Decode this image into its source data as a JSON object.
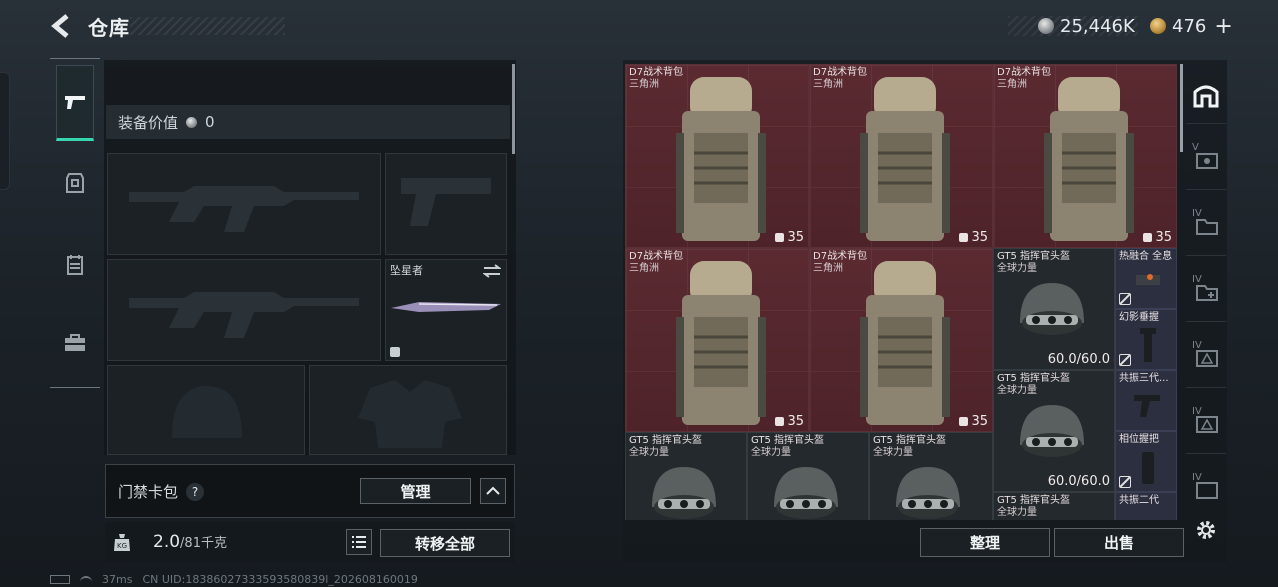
{
  "header": {
    "title": "仓库",
    "currency_silver": "25,446K",
    "currency_gold": "476",
    "gold_plus": "+"
  },
  "equipment": {
    "value_label": "装备价值",
    "value": "0",
    "melee_name": "坠星者"
  },
  "card_pack": {
    "label": "门禁卡包",
    "help": "?",
    "manage_label": "管理"
  },
  "bottom_left": {
    "weight_current": "2.0",
    "weight_max": "/81千克",
    "transfer_all_label": "转移全部"
  },
  "grid_items": {
    "backpack_name": "D7战术背包",
    "backpack_sub": "三角洲",
    "backpack_count": "35",
    "helmet_name": "GT5 指挥官头盔",
    "helmet_sub": "全球力量",
    "helmet_durability": "60.0/60.0",
    "small_1": "热融合 全息",
    "small_2": "幻影垂握",
    "small_3": "共振三代...",
    "small_4": "相位握把",
    "small_5": "共振二代"
  },
  "right_nav": {
    "labels": [
      "V",
      "IV",
      "IV",
      "IV",
      "IV",
      "IV"
    ]
  },
  "actions": {
    "sort_label": "整理",
    "sell_label": "出售"
  },
  "status_bar": {
    "ping": "37ms",
    "uid": "CN UID:18386027333593580839l_202608160019"
  },
  "colors": {
    "accent": "#37d6b0",
    "item_red": "#5b2a31"
  }
}
